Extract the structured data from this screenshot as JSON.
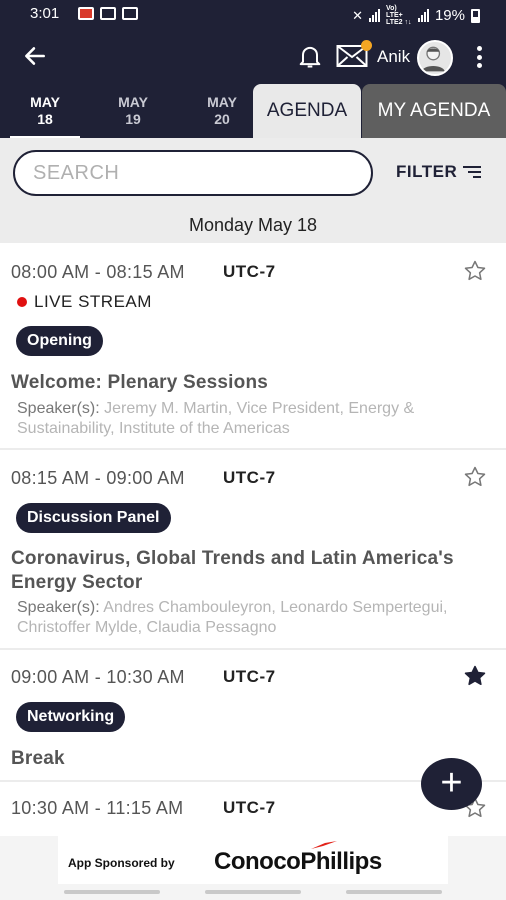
{
  "status_bar": {
    "time": "3:01",
    "battery": "19%",
    "network": "Vo) LTE+ LTE2 ↑↓"
  },
  "app_bar": {
    "user_name": "Anik"
  },
  "date_tabs": [
    {
      "month": "MAY",
      "day": "18",
      "active": true
    },
    {
      "month": "MAY",
      "day": "19",
      "active": false
    },
    {
      "month": "MAY",
      "day": "20",
      "active": false
    }
  ],
  "view_tabs": {
    "agenda": "AGENDA",
    "my_agenda": "MY AGENDA"
  },
  "search": {
    "placeholder": "SEARCH",
    "filter_label": "FILTER"
  },
  "day_label": "Monday May 18",
  "sessions": [
    {
      "time": "08:00 AM - 08:15 AM",
      "tz": "UTC-7",
      "live": "LIVE STREAM",
      "tag": "Opening",
      "title": "Welcome: Plenary Sessions",
      "speakers_label": "Speaker(s):",
      "speakers": "Jeremy M. Martin, Vice President, Energy & Sustainability, Institute of the Americas",
      "starred": false
    },
    {
      "time": "08:15 AM - 09:00 AM",
      "tz": "UTC-7",
      "tag": "Discussion Panel",
      "title": "Coronavirus, Global Trends and Latin America's Energy Sector",
      "speakers_label": "Speaker(s):",
      "speakers": "Andres Chambouleyron, Leonardo Sempertegui, Christoffer Mylde, Claudia Pessagno",
      "starred": false
    },
    {
      "time": "09:00 AM - 10:30 AM",
      "tz": "UTC-7",
      "tag": "Networking",
      "title": "Break",
      "starred": true
    },
    {
      "time": "10:30 AM - 11:15 AM",
      "tz": "UTC-7",
      "starred": false
    }
  ],
  "footer": {
    "sponsor_label": "App Sponsored by",
    "sponsor_name": "ConocoPhillips"
  },
  "colors": {
    "navy": "#1f2136",
    "live_dot": "#e01010",
    "mail_badge": "#f5a623",
    "logo_red": "#e2231a"
  }
}
